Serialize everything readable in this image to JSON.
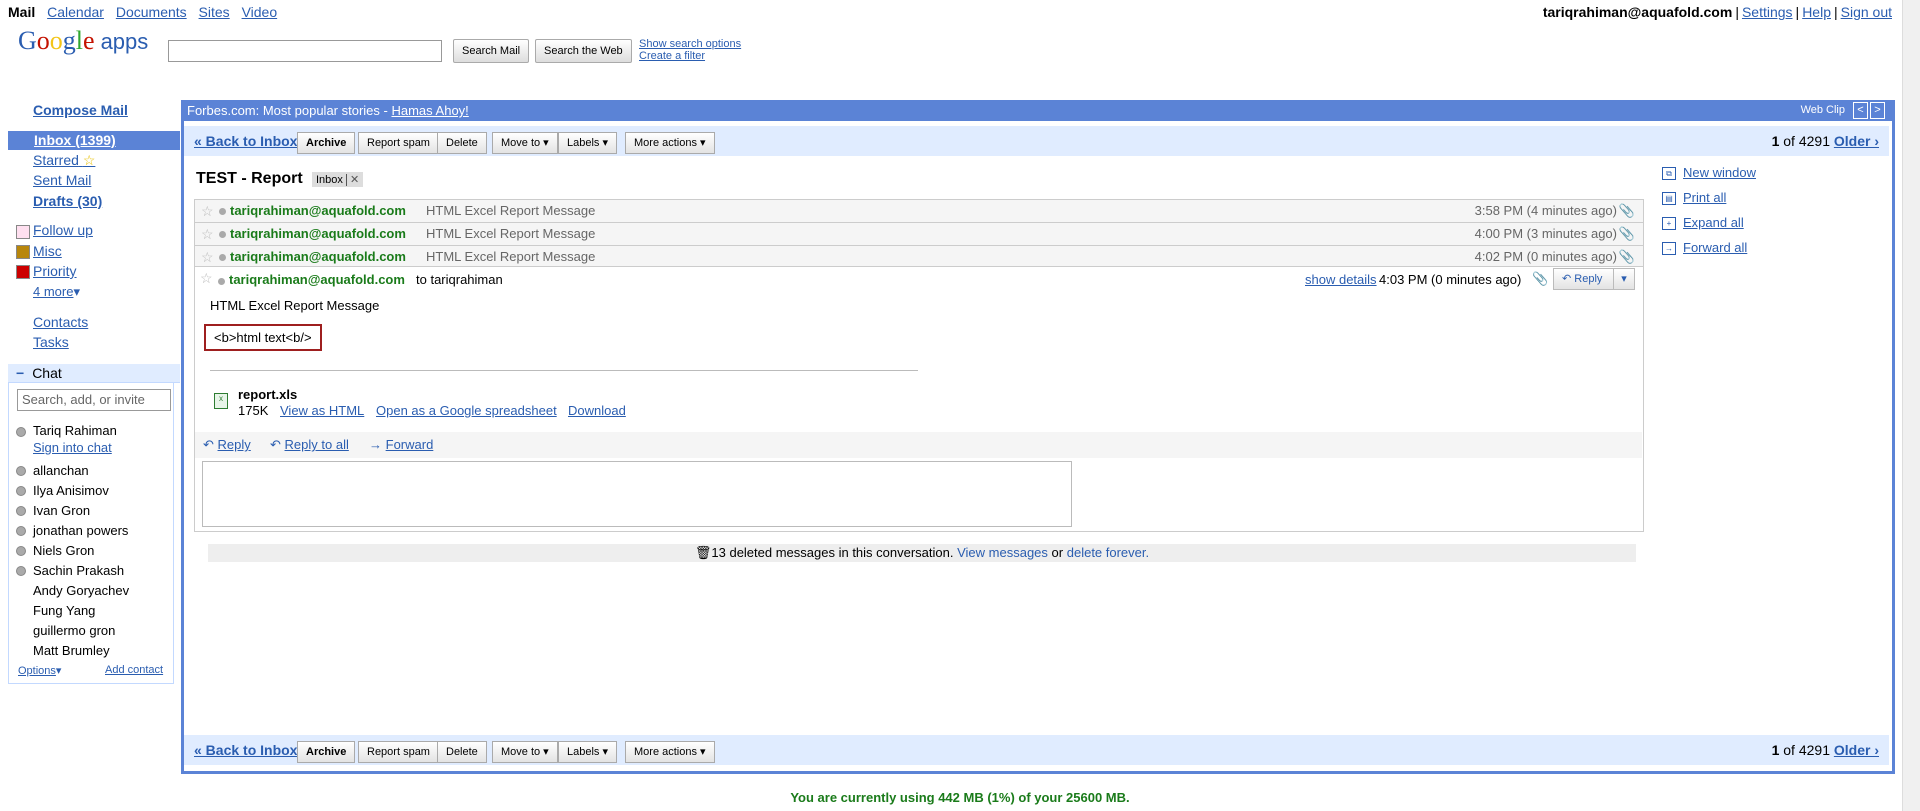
{
  "topnav": {
    "items": [
      "Mail",
      "Calendar",
      "Documents",
      "Sites",
      "Video"
    ]
  },
  "account": {
    "email": "tariqrahiman@aquafold.com",
    "settings": "Settings",
    "help": "Help",
    "signout": "Sign out"
  },
  "logo": {
    "text": "Google",
    "suffix": "apps"
  },
  "search": {
    "mail_button": "Search Mail",
    "web_button": "Search the Web",
    "show_options": "Show search options",
    "create_filter": "Create a filter"
  },
  "nav": {
    "compose": "Compose Mail",
    "inbox": "Inbox (1399)",
    "starred": "Starred",
    "sent": "Sent Mail",
    "drafts": "Drafts (30)",
    "labels": [
      {
        "name": "Follow up",
        "color": "#ffe0f0"
      },
      {
        "name": "Misc",
        "color": "#b8860b"
      },
      {
        "name": "Priority",
        "color": "#cc0000"
      }
    ],
    "more": "4 more",
    "contacts": "Contacts",
    "tasks": "Tasks"
  },
  "chat": {
    "header": "Chat",
    "search_placeholder": "Search, add, or invite",
    "me": "Tariq Rahiman",
    "sign_in": "Sign into chat",
    "contacts_with_status": [
      "allanchan",
      "Ilya Anisimov",
      "Ivan Gron",
      "jonathan powers",
      "Niels Gron",
      "Sachin Prakash"
    ],
    "contacts_no_status": [
      "Andy Goryachev",
      "Fung Yang",
      "guillermo gron",
      "Matt Brumley"
    ],
    "options": "Options",
    "add_contact": "Add contact"
  },
  "webclip": {
    "source": "Forbes.com: Most popular stories - ",
    "headline": "Hamas Ahoy!",
    "label": "Web Clip",
    "prev": "<",
    "next": ">"
  },
  "actions": {
    "back": "« Back to Inbox",
    "archive": "Archive",
    "spam": "Report spam",
    "delete": "Delete",
    "move": "Move to ▾",
    "labels": "Labels ▾",
    "more": "More actions ▾",
    "pager_current": "1",
    "pager_of": "of 4291",
    "older": "Older ›"
  },
  "conversation": {
    "subject": "TEST - Report",
    "tag": "Inbox",
    "messages": [
      {
        "from": "tariqrahiman@aquafold.com",
        "snippet": "HTML Excel Report Message",
        "time": "3:58 PM (4 minutes ago)"
      },
      {
        "from": "tariqrahiman@aquafold.com",
        "snippet": "HTML Excel Report Message",
        "time": "4:00 PM (3 minutes ago)"
      },
      {
        "from": "tariqrahiman@aquafold.com",
        "snippet": "HTML Excel Report Message",
        "time": "4:02 PM (0 minutes ago)"
      }
    ],
    "open": {
      "from": "tariqrahiman@aquafold.com",
      "to": "to tariqrahiman",
      "show_details": "show details",
      "time": "4:03 PM (0 minutes ago)",
      "reply": "Reply",
      "body_line": "HTML Excel Report Message",
      "html_text": "<b>html text<b/>",
      "attachment": {
        "name": "report.xls",
        "size": "175K",
        "view_html": "View as HTML",
        "open_spreadsheet": "Open as a Google spreadsheet",
        "download": "Download"
      },
      "reply_link": "Reply",
      "reply_all": "Reply to all",
      "forward": "Forward"
    },
    "deleted_notice": {
      "text": "13 deleted messages in this conversation.",
      "view": "View messages",
      "or": "or",
      "delete_forever": "delete forever."
    }
  },
  "right_links": [
    "New window",
    "Print all",
    "Expand all",
    "Forward all"
  ],
  "storage": "You are currently using 442 MB (1%) of your 25600 MB."
}
